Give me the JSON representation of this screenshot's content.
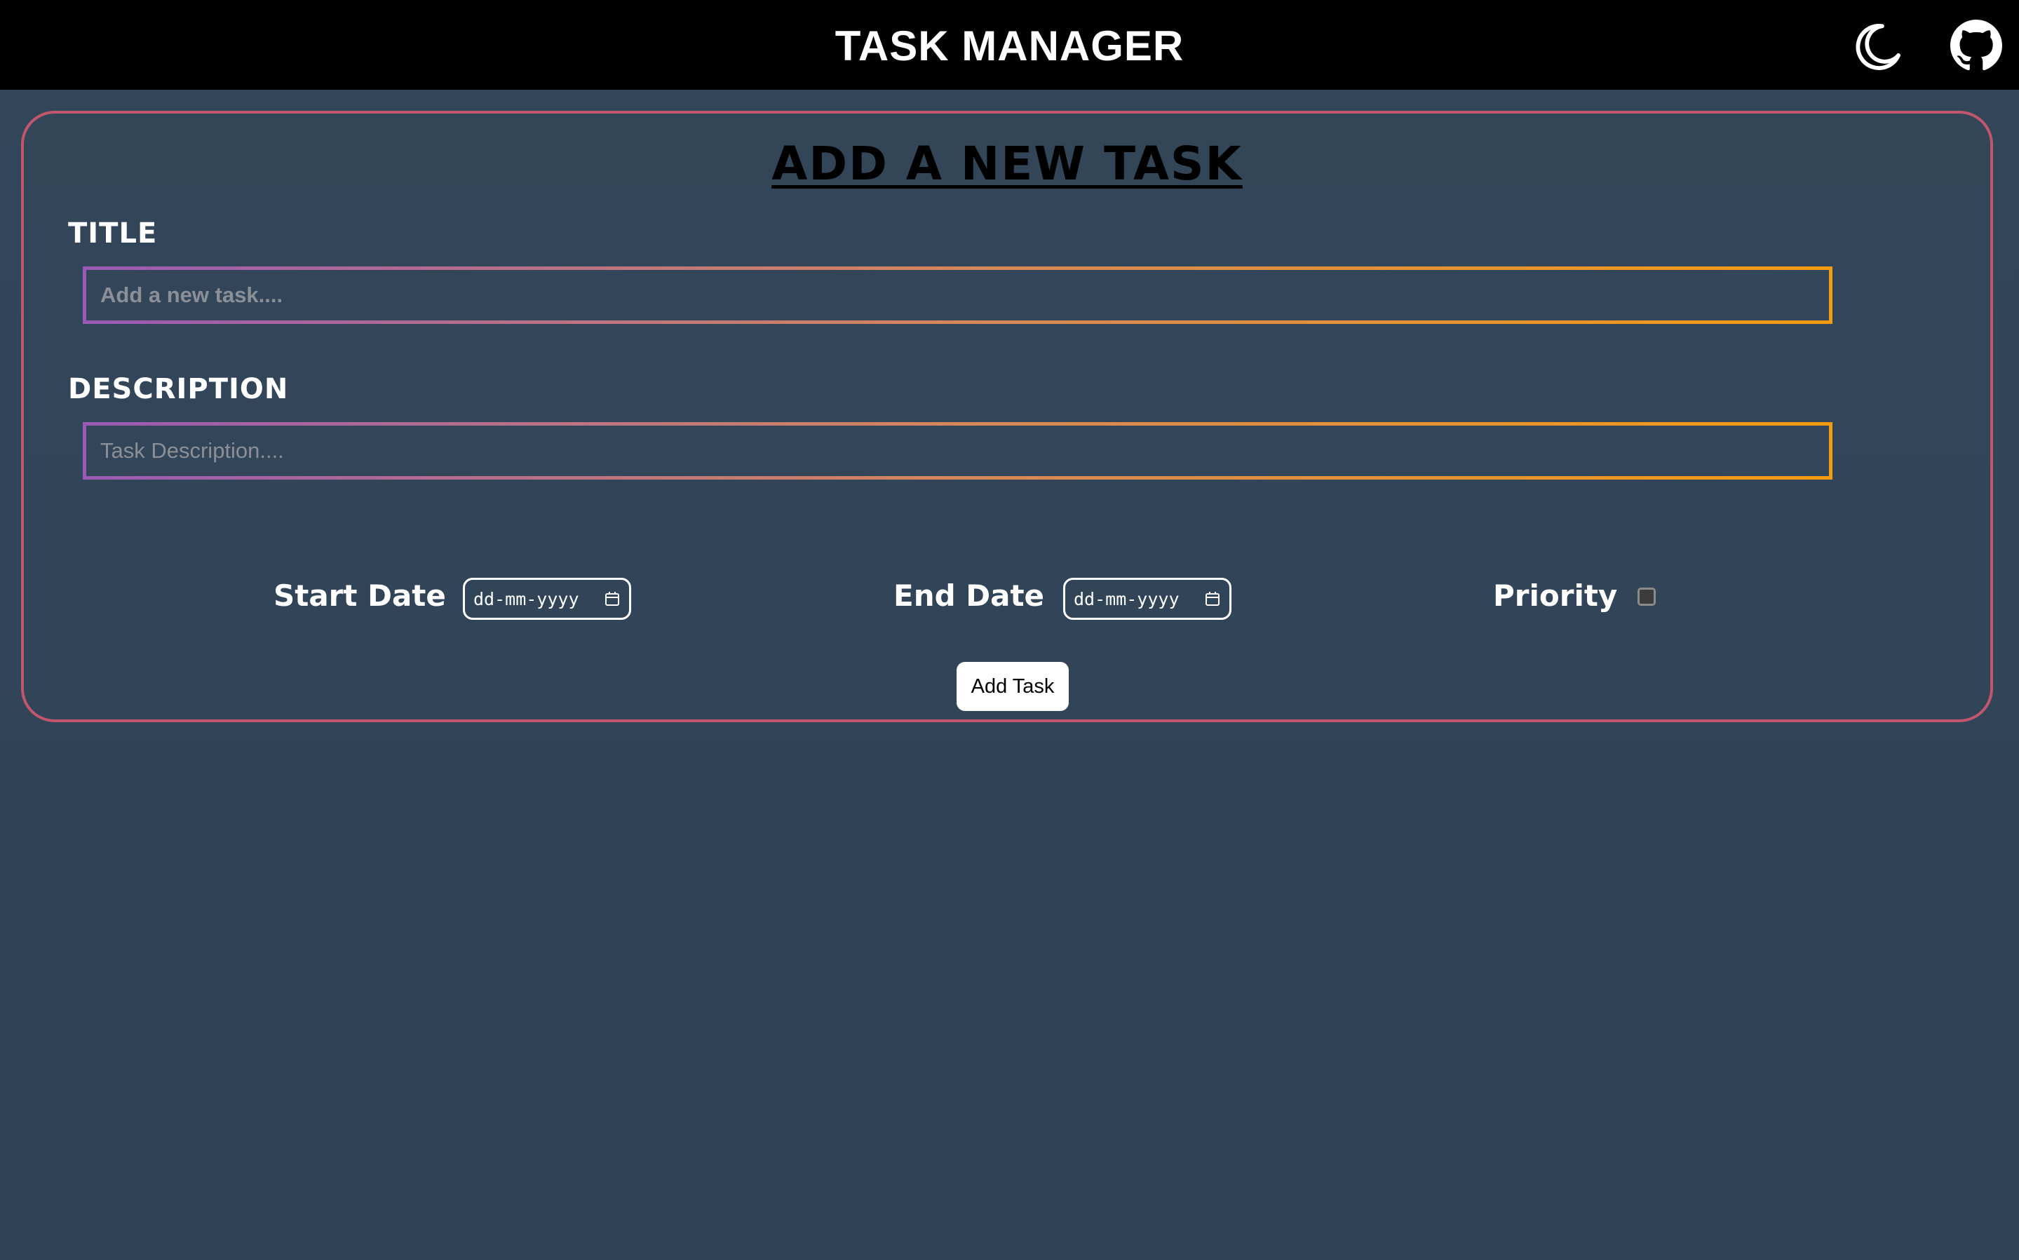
{
  "header": {
    "title": "TASK MANAGER",
    "theme_toggle_icon": "moon-icon",
    "github_icon": "github-icon"
  },
  "form": {
    "heading": "ADD A NEW TASK",
    "title_label": "TITLE",
    "title_value": "",
    "title_placeholder": "Add a new task....",
    "description_label": "DESCRIPTION",
    "description_value": "",
    "description_placeholder": "Task Description....",
    "start_date_label": "Start Date",
    "start_date_value": "dd-mm-yyyy",
    "end_date_label": "End Date",
    "end_date_value": "dd-mm-yyyy",
    "priority_label": "Priority",
    "priority_checked": false,
    "submit_label": "Add Task"
  },
  "colors": {
    "header_bg": "#000000",
    "page_bg": "#334659",
    "card_border": "#c2566d",
    "input_border_start": "#9b59b6",
    "input_border_end": "#f39c12"
  }
}
